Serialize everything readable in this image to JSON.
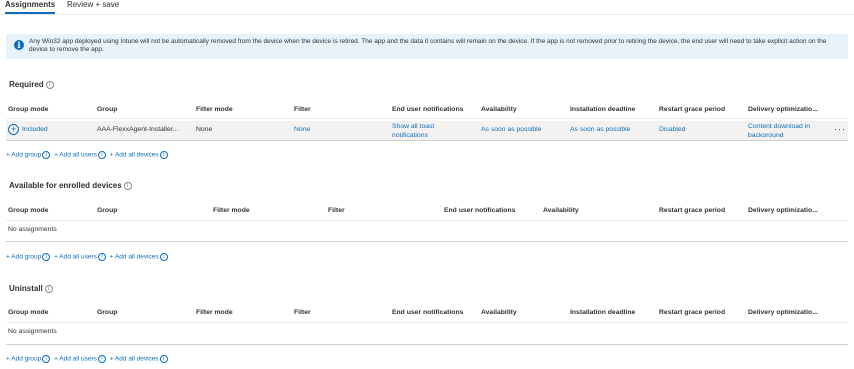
{
  "tabs": [
    {
      "label": "Assignments",
      "active": true
    },
    {
      "label": "Review + save",
      "active": false
    }
  ],
  "banner": {
    "text": "Any Win32 app deployed using Intune will not be automatically removed from the device when the device is retired. The app and the data it contains will remain on the device. If the app is not removed prior to retiring the device, the end user will need to take explicit action on the device to remove the app."
  },
  "headers_full": [
    "Group mode",
    "Group",
    "Filter mode",
    "Filter",
    "End user notifications",
    "Availability",
    "Installation deadline",
    "Restart grace period",
    "Delivery optimizatio..."
  ],
  "headers_available": [
    "Group mode",
    "Group",
    "Filter mode",
    "Filter",
    "End user notifications",
    "Availability",
    "Restart grace period",
    "Delivery optimizatio..."
  ],
  "required": {
    "title": "Required",
    "row": {
      "group_mode": "Included",
      "group": "AAA-FlexxAgent-Installer...",
      "filter_mode": "None",
      "filter": "None",
      "notifications": "Show all toast notifications",
      "availability": "As soon as possible",
      "deadline": "As soon as possible",
      "restart": "Disabled",
      "delivery": "Content download in backoround",
      "more": "···"
    }
  },
  "available": {
    "title": "Available for enrolled devices",
    "empty": "No assignments"
  },
  "uninstall": {
    "title": "Uninstall",
    "empty": "No assignments"
  },
  "add_links": {
    "add_group": "+ Add group",
    "add_users": "+ Add all users",
    "add_devices": "+ Add all devices"
  },
  "colors": {
    "accent": "#0f6cbd",
    "banner_bg": "#e8f2fb",
    "row_bg": "#f3f2f1"
  }
}
